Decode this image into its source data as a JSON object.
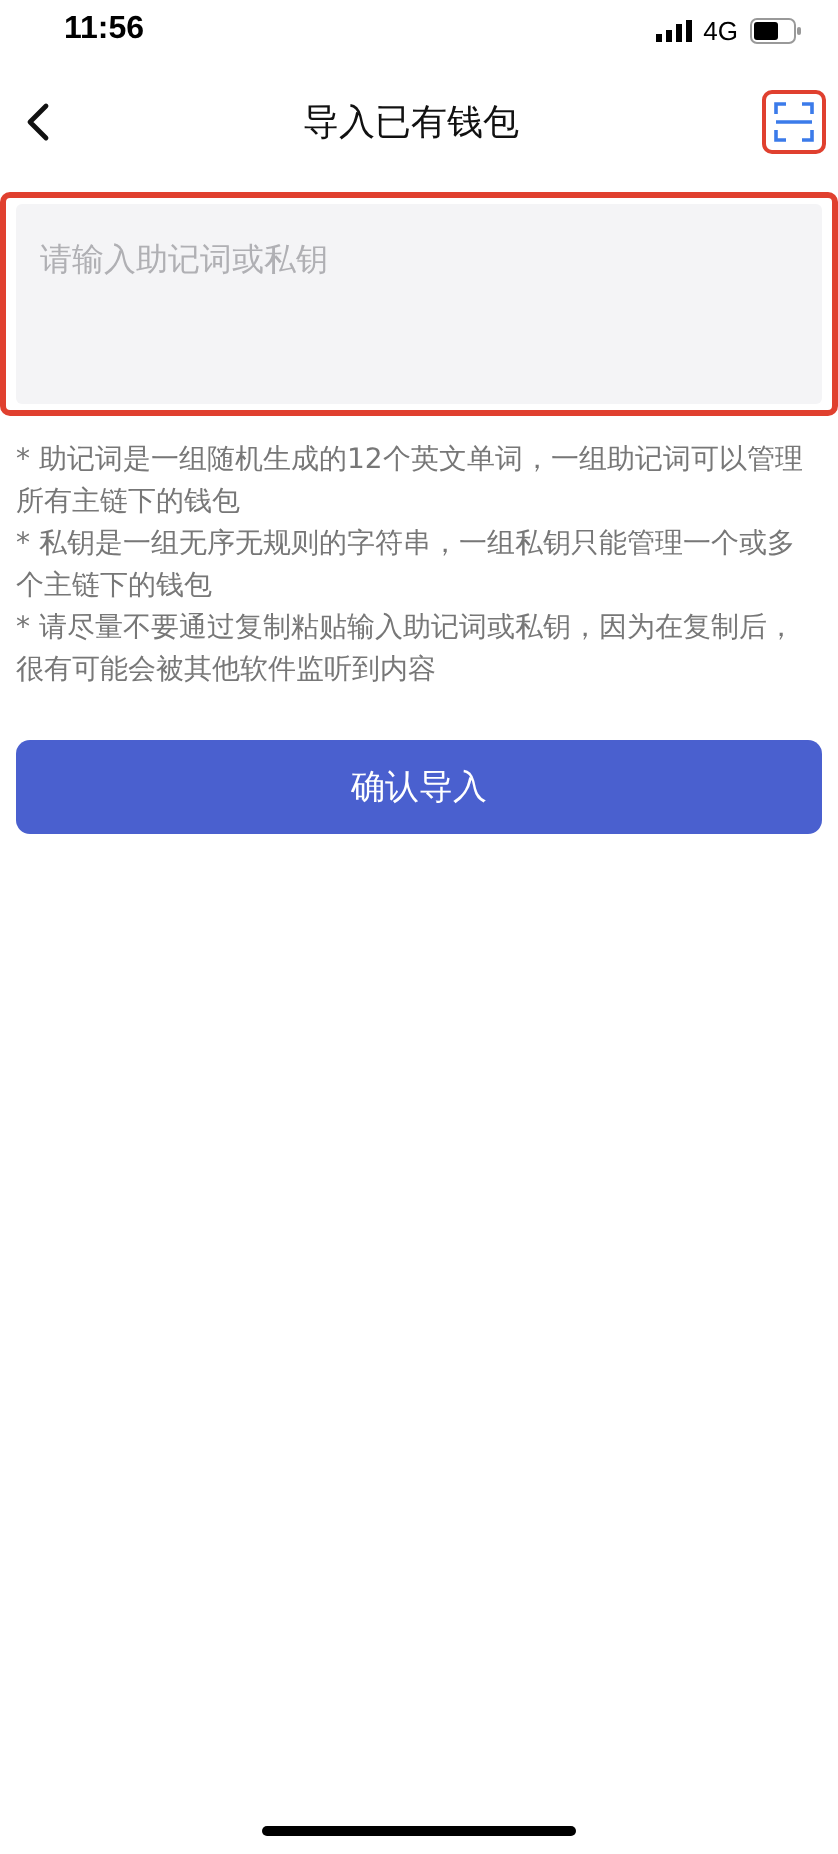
{
  "status_bar": {
    "time": "11:56",
    "network": "4G"
  },
  "nav": {
    "title": "导入已有钱包"
  },
  "input": {
    "placeholder": "请输入助记词或私钥"
  },
  "notes": [
    "* 助记词是一组随机生成的12个英文单词，一组助记词可以管理所有主链下的钱包",
    "* 私钥是一组无序无规则的字符串，一组私钥只能管理一个或多个主链下的钱包",
    "* 请尽量不要通过复制粘贴输入助记词或私钥，因为在复制后，很有可能会被其他软件监听到内容"
  ],
  "confirm_button": "确认导入"
}
